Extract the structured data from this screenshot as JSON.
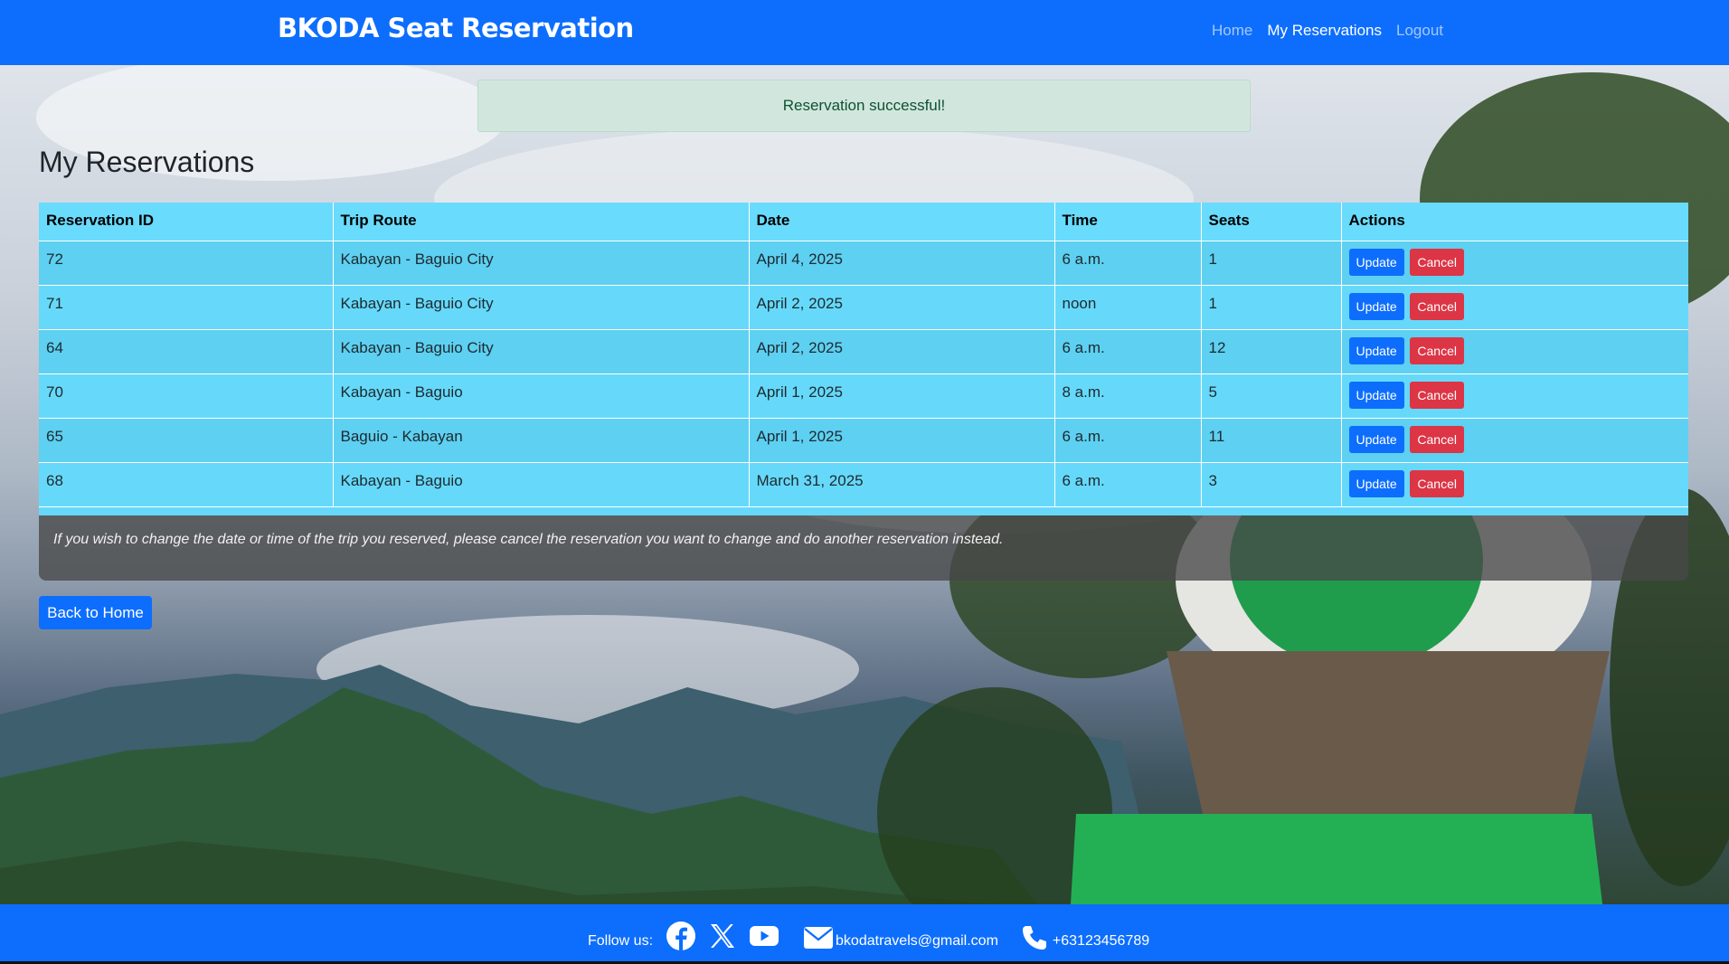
{
  "navbar": {
    "brand": "BKODA Seat Reservation",
    "links": [
      {
        "label": "Home",
        "active": false
      },
      {
        "label": "My Reservations",
        "active": true
      },
      {
        "label": "Logout",
        "active": false
      }
    ]
  },
  "alert": {
    "message": "Reservation successful!"
  },
  "page": {
    "title": "My Reservations"
  },
  "table": {
    "headers": [
      "Reservation ID",
      "Trip Route",
      "Date",
      "Time",
      "Seats",
      "Actions"
    ],
    "rows": [
      {
        "id": "72",
        "route": "Kabayan - Baguio City",
        "date": "April 4, 2025",
        "time": "6 a.m.",
        "seats": "1"
      },
      {
        "id": "71",
        "route": "Kabayan - Baguio City",
        "date": "April 2, 2025",
        "time": "noon",
        "seats": "1"
      },
      {
        "id": "64",
        "route": "Kabayan - Baguio City",
        "date": "April 2, 2025",
        "time": "6 a.m.",
        "seats": "12"
      },
      {
        "id": "70",
        "route": "Kabayan - Baguio",
        "date": "April 1, 2025",
        "time": "8 a.m.",
        "seats": "5"
      },
      {
        "id": "65",
        "route": "Baguio - Kabayan",
        "date": "April 1, 2025",
        "time": "6 a.m.",
        "seats": "11"
      },
      {
        "id": "68",
        "route": "Kabayan - Baguio",
        "date": "March 31, 2025",
        "time": "6 a.m.",
        "seats": "3"
      }
    ],
    "update_label": "Update",
    "cancel_label": "Cancel"
  },
  "note": "If you wish to change the date or time of the trip you reserved, please cancel the reservation you want to change and do another reservation instead.",
  "back_button": "Back to Home",
  "footer": {
    "follow_label": "Follow us:",
    "social_icons": [
      "facebook-icon",
      "x-icon",
      "youtube-icon"
    ],
    "email": "bkodatravels@gmail.com",
    "phone": "+63123456789"
  },
  "colors": {
    "primary": "#0d6efd",
    "danger": "#dc3545",
    "table_bg": "#66d9fa",
    "alert_bg": "#d1e7dd"
  }
}
